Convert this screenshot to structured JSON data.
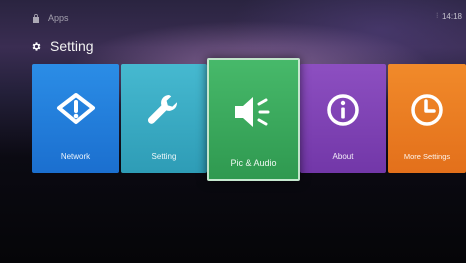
{
  "header": {
    "breadcrumb": "Apps",
    "clock": "14:18",
    "page_title": "Setting"
  },
  "tiles": [
    {
      "label": "Network",
      "icon": "network-icon",
      "color": "#2b8de6"
    },
    {
      "label": "Setting",
      "icon": "wrench-icon",
      "color": "#46b9d0"
    },
    {
      "label": "Pic & Audio",
      "icon": "speaker-icon",
      "color": "#47b96a",
      "selected": true
    },
    {
      "label": "About",
      "icon": "info-icon",
      "color": "#8d4fc1"
    },
    {
      "label": "More Settings",
      "icon": "clock-icon",
      "color": "#f18a2a"
    }
  ]
}
